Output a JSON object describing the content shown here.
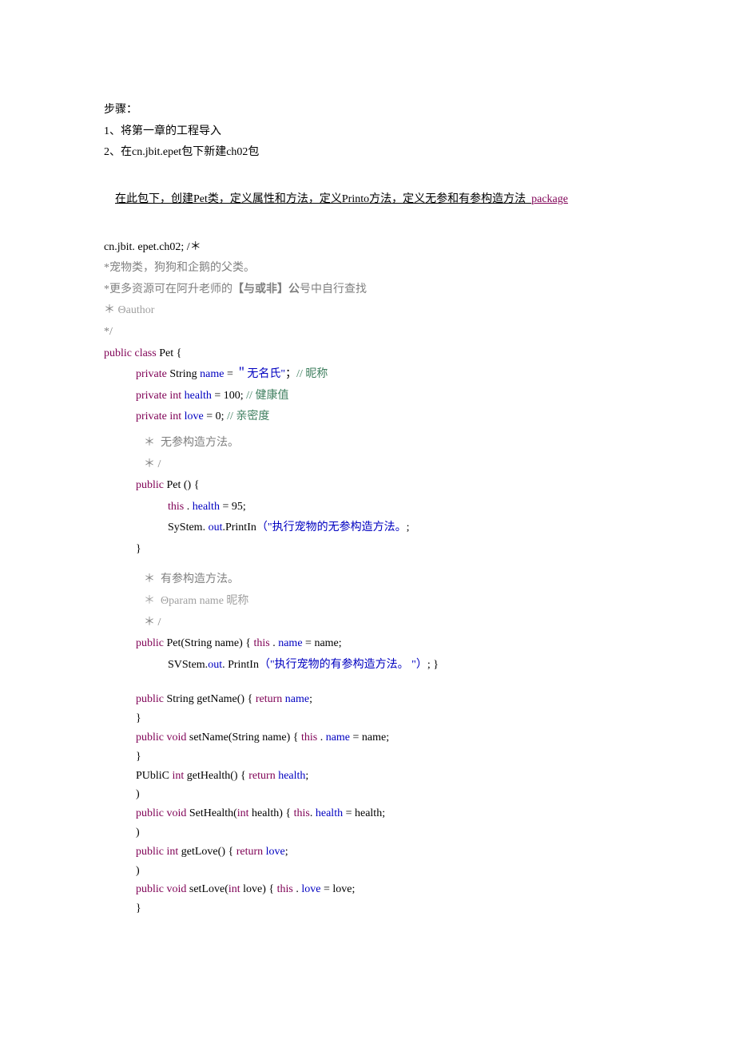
{
  "lines": {
    "l1": "步骤：",
    "l2": "1、将第一章的工程导入",
    "l3": "2、在cn.jbit.epet包下新建ch02包",
    "l4a": "在此包下，创建Pet类，定义属性和方法，定义Printo方法，定义无参和有参构造方法  ",
    "l4b": "package",
    "l5": "cn.jbit. epet.ch02; /＊",
    "l6a": "*",
    "l6b": "宠物类，狗狗和企鹅的父类。",
    "l7a": "*更多资源可在阿升老师的",
    "l7b_bold": "【与或非】公",
    "l7c": "号中自行查找",
    "l8a": "＊",
    "l8b": " Θauthor",
    "l9": "*/",
    "l10a": "public class",
    "l10b": " Pet {",
    "l11a": "private",
    "l11b": " String ",
    "l11c": "name",
    "l11d": " = ",
    "l11e": "＂无名氏\"",
    "l11f": "；",
    "l11g": "// 昵称",
    "l12a": "private int ",
    "l12b": "health",
    "l12c": " = 100; ",
    "l12d": "// 健康值",
    "l13a": "private int ",
    "l13b": "love",
    "l13c": " = 0; ",
    "l13d": "// 亲密度",
    "l14": "＊  无参构造方法。",
    "l15": "＊ /",
    "l16a": "public",
    "l16b": " Pet () {",
    "l17a": "this",
    "l17b": " . ",
    "l17c": "health",
    "l17d": " = 95;",
    "l18a": "SyStem. ",
    "l18b": "out",
    "l18c": ".PrintIn",
    "l18d": "（\"执行宠物的无参构造方法。",
    "l18e": ";",
    "l19": "}",
    "l20": "＊  有参构造方法。",
    "l21": "＊  Θparam name 昵称",
    "l22": "＊ /",
    "l23a": "public",
    "l23b": " Pet(String name) { ",
    "l23c": "this",
    "l23d": " . ",
    "l23e": "name",
    "l23f": " = name;",
    "l24a": "SVStem.",
    "l24b": "out",
    "l24c": ". PrintIn",
    "l24d": "（\"执行宠物的有参构造方法。 \"）",
    "l24e": "; }",
    "l25a": "public",
    "l25b": " String getName() { ",
    "l25c": "return ",
    "l25d": "name",
    "l25e": ";",
    "l26": "}",
    "l27a": "public void",
    "l27b": " setName(String name) { ",
    "l27c": "this",
    "l27d": " . ",
    "l27e": "name",
    "l27f": " = name;",
    "l28": "}",
    "l29a": "PUbliC ",
    "l29b": "int",
    "l29c": " getHealth() { ",
    "l29d": "return ",
    "l29e": "health",
    "l29f": ";",
    "l30": ")",
    "l31a": "public void",
    "l31b": " SetHealth(",
    "l31c": "int",
    "l31d": " health) { ",
    "l31e": "this",
    "l31f": ". ",
    "l31g": "health",
    "l31h": " = health;",
    "l32": ")",
    "l33a": "public int",
    "l33b": " getLove() { ",
    "l33c": "return ",
    "l33d": "love",
    "l33e": ";",
    "l34": ")",
    "l35a": "public void",
    "l35b": " setLove(",
    "l35c": "int",
    "l35d": " love) { ",
    "l35e": "this",
    "l35f": " . ",
    "l35g": "love",
    "l35h": " = love;",
    "l36": "}"
  }
}
